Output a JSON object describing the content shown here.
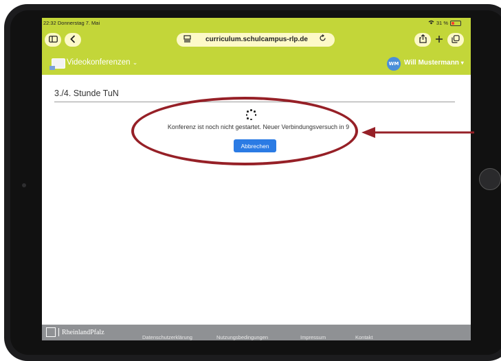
{
  "status_bar": {
    "time": "22:32 Donnerstag 7. Mai",
    "battery": "31 %"
  },
  "browser": {
    "url": "curriculum.schulcampus-rlp.de",
    "icons": [
      "sidebar-icon",
      "back-chevron-icon",
      "page-icon",
      "reload-icon",
      "share-icon",
      "plus-icon",
      "tabs-icon"
    ]
  },
  "header": {
    "module_title": "Videokonferenzen",
    "module_chevron": "⌄",
    "user_initials": "WM",
    "user_name": "Will Mustermann",
    "user_chevron": "▾"
  },
  "main": {
    "page_title": "3./4. Stunde TuN",
    "message": "Konferenz ist noch nicht gestartet. Neuer Verbindungsversuch in 9",
    "cancel_label": "Abbrechen"
  },
  "footer": {
    "brand": "RheinlandPfalz",
    "links": [
      "Datenschutzerklärung",
      "Nutzungsbedingungen",
      "Impressum",
      "Kontakt"
    ]
  },
  "colors": {
    "accent_green": "#c3d639",
    "button_blue": "#2b7be4",
    "annotation_red": "#962027",
    "footer_gray": "#8f9194"
  }
}
